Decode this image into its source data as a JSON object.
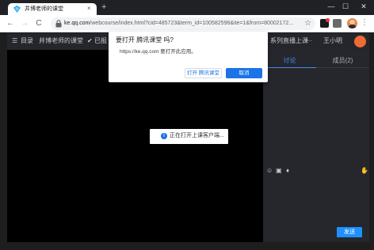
{
  "browser": {
    "tab_title": "井博老师的课堂",
    "tab_close": "×",
    "new_tab": "+",
    "window_controls": {
      "minimize": "—",
      "maximize": "☐",
      "close": "✕"
    },
    "nav": {
      "back": "←",
      "forward": "→",
      "reload": "C"
    },
    "url_host": "ke.qq.com",
    "url_rest": "/webcourse/index.html?cid=485723&term_id=100582596&ite=1&from=80002172...",
    "star": "☆",
    "menu": "⋮"
  },
  "header": {
    "menu_icon": "☰",
    "catalog": "目录",
    "course_name": "井博老师的课堂",
    "check_icon": "✔",
    "status": "已报",
    "live_title": "系列直播上课",
    "more": "···",
    "user_name": "王小明"
  },
  "dialog": {
    "title": "要打开 腾讯课堂 吗?",
    "message": "https://ke.qq.com 要打开此应用。",
    "open_label": "打开 腾讯课堂",
    "cancel_label": "取消"
  },
  "video": {
    "notice": "正在打开上课客户端..."
  },
  "side": {
    "tabs": [
      {
        "label": "讨论",
        "active": true
      },
      {
        "label": "成员(2)",
        "active": false
      }
    ],
    "tools": {
      "emoji": "☺",
      "image": "▣",
      "mic": "♦",
      "hand": "✋"
    },
    "send_label": "发送"
  },
  "colors": {
    "accent": "#1a73e8",
    "side_active": "#3b8ff0",
    "send": "#1e90ff"
  }
}
